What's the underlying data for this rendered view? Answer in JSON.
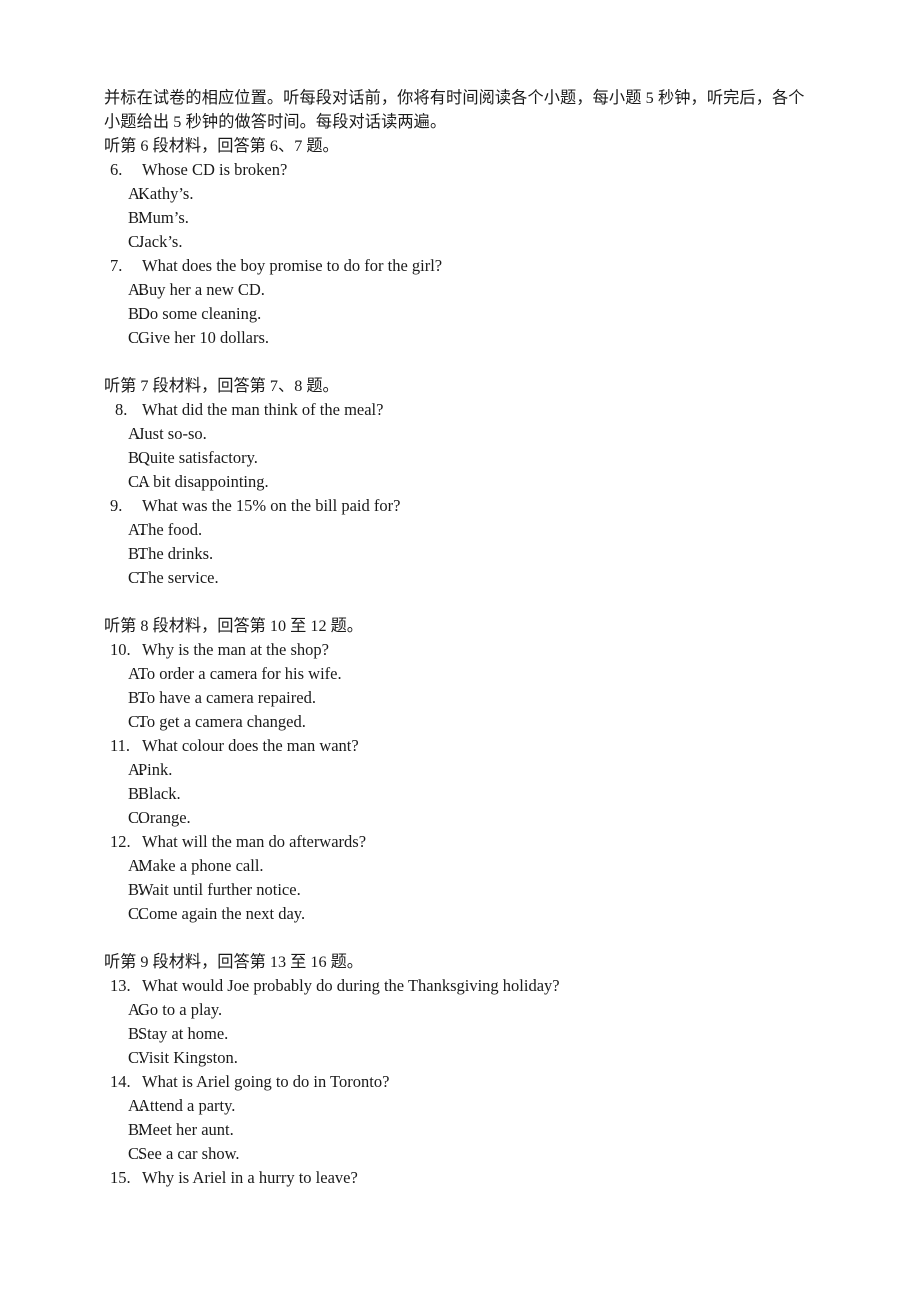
{
  "page": {
    "background_color": "#ffffff",
    "text_color": "#1a1a1a"
  },
  "intro": {
    "line1": "并标在试卷的相应位置。听每段对话前，你将有时间阅读各个小题，每小题 5 秒钟，听完后，各个",
    "line2": "小题给出 5 秒钟的做答时间。每段对话读两遍。"
  },
  "sections": [
    {
      "header": "听第 6 段材料，回答第 6、7 题。",
      "questions": [
        {
          "number": "6.",
          "text": "Whose CD is broken?",
          "options": [
            {
              "letter": "A.",
              "text": "Kathy’s."
            },
            {
              "letter": "B.",
              "text": "Mum’s."
            },
            {
              "letter": "C.",
              "text": "Jack’s."
            }
          ]
        },
        {
          "number": "7.",
          "text": "What does the boy promise to do for the girl?",
          "options": [
            {
              "letter": "A.",
              "text": "Buy her a new CD."
            },
            {
              "letter": "B.",
              "text": "Do some cleaning."
            },
            {
              "letter": "C.",
              "text": "Give her 10 dollars."
            }
          ]
        }
      ]
    },
    {
      "header": "听第 7 段材料，回答第 7、8 题。",
      "questions": [
        {
          "number": "8.",
          "text": "What did the man think of the meal?",
          "options": [
            {
              "letter": "A.",
              "text": "Just so-so."
            },
            {
              "letter": "B.",
              "text": "Quite satisfactory."
            },
            {
              "letter": "C.",
              "text": "A bit disappointing."
            }
          ]
        },
        {
          "number": "9.",
          "text": "What was the 15% on the bill paid for?",
          "options": [
            {
              "letter": "A.",
              "text": "The food."
            },
            {
              "letter": "B.",
              "text": "The drinks."
            },
            {
              "letter": "C.",
              "text": "The service."
            }
          ]
        }
      ]
    },
    {
      "header": "听第 8 段材料，回答第 10 至 12 题。",
      "questions": [
        {
          "number": "10.",
          "text": "Why is the man at the shop?",
          "options": [
            {
              "letter": "A.",
              "text": "To order a camera for his wife."
            },
            {
              "letter": "B.",
              "text": "To have a camera repaired."
            },
            {
              "letter": "C.",
              "text": "To get a camera changed."
            }
          ]
        },
        {
          "number": "11.",
          "text": "What colour does the man want?",
          "options": [
            {
              "letter": "A.",
              "text": "Pink."
            },
            {
              "letter": "B.",
              "text": "Black."
            },
            {
              "letter": "C.",
              "text": "Orange."
            }
          ]
        },
        {
          "number": "12.",
          "text": "What will the man do afterwards?",
          "options": [
            {
              "letter": "A.",
              "text": "Make a phone call."
            },
            {
              "letter": "B.",
              "text": "Wait until further notice."
            },
            {
              "letter": "C.",
              "text": "Come again the next day."
            }
          ]
        }
      ]
    },
    {
      "header": "听第 9 段材料，回答第 13 至 16 题。",
      "questions": [
        {
          "number": "13.",
          "text": "What would Joe probably do during the Thanksgiving holiday?",
          "options": [
            {
              "letter": "A.",
              "text": "Go to a play."
            },
            {
              "letter": "B.",
              "text": "Stay at home."
            },
            {
              "letter": "C.",
              "text": "Visit Kingston."
            }
          ]
        },
        {
          "number": "14.",
          "text": "What is Ariel going to do in Toronto?",
          "options": [
            {
              "letter": "A.",
              "text": "Attend a party."
            },
            {
              "letter": "B.",
              "text": "Meet her aunt."
            },
            {
              "letter": "C.",
              "text": "See a car show."
            }
          ]
        },
        {
          "number": "15.",
          "text": "Why is Ariel in a hurry to leave?",
          "options": []
        }
      ]
    }
  ]
}
